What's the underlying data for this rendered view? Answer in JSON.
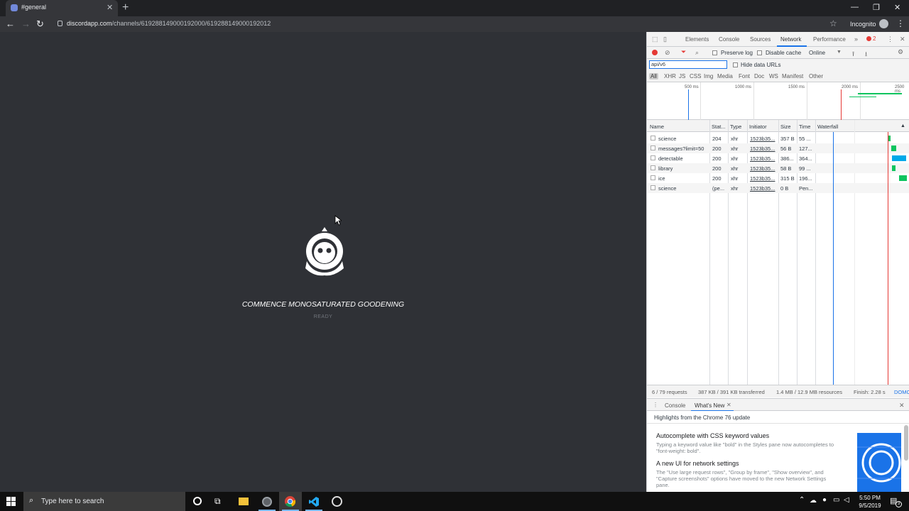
{
  "browser": {
    "tab_title": "#general",
    "url_host": "discordapp.com",
    "url_path": "/channels/619288149000192000/619288149000192012",
    "profile_label": "Incognito"
  },
  "discord": {
    "tagline": "COMMENCE MONOSATURATED GOODENING",
    "status": "READY"
  },
  "devtools": {
    "tabs": [
      "Elements",
      "Console",
      "Sources",
      "Network",
      "Performance"
    ],
    "error_count": "2",
    "toolbar": {
      "preserve_log": "Preserve log",
      "disable_cache": "Disable cache",
      "throttle": "Online"
    },
    "filter_value": "api/v6",
    "hide_data_urls": "Hide data URLs",
    "type_filters": [
      "All",
      "XHR",
      "JS",
      "CSS",
      "Img",
      "Media",
      "Font",
      "Doc",
      "WS",
      "Manifest",
      "Other"
    ],
    "overview_ticks": [
      "500 ms",
      "1000 ms",
      "1500 ms",
      "2000 ms",
      "2500 ms"
    ],
    "columns": [
      "Name",
      "Stat...",
      "Type",
      "Initiator",
      "Size",
      "Time",
      "Waterfall"
    ],
    "requests": [
      {
        "name": "science",
        "status": "204",
        "type": "xhr",
        "initiator": "1523b35...",
        "size": "357 B",
        "time": "55 ..."
      },
      {
        "name": "messages?limit=50",
        "status": "200",
        "type": "xhr",
        "initiator": "1523b35...",
        "size": "56 B",
        "time": "127..."
      },
      {
        "name": "detectable",
        "status": "200",
        "type": "xhr",
        "initiator": "1523b35...",
        "size": "386...",
        "time": "364..."
      },
      {
        "name": "library",
        "status": "200",
        "type": "xhr",
        "initiator": "1523b35...",
        "size": "58 B",
        "time": "99 ..."
      },
      {
        "name": "ice",
        "status": "200",
        "type": "xhr",
        "initiator": "1523b35...",
        "size": "315 B",
        "time": "196..."
      },
      {
        "name": "science",
        "status": "(pe...",
        "type": "xhr",
        "initiator": "1523b35...",
        "size": "0 B",
        "time": "Pen..."
      }
    ],
    "summary": {
      "requests": "6 / 79 requests",
      "transferred": "387 KB / 391 KB transferred",
      "resources": "1.4 MB / 12.9 MB resources",
      "finish": "Finish: 2.28 s",
      "domcontent": "DOMC"
    },
    "drawer": {
      "tabs": [
        "Console",
        "What's New"
      ],
      "highlights": "Highlights from the Chrome 76 update",
      "items": [
        {
          "title": "Autocomplete with CSS keyword values",
          "body": "Typing a keyword value like \"bold\" in the Styles pane now autocompletes to \"font-weight: bold\"."
        },
        {
          "title": "A new UI for network settings",
          "body": "The \"Use large request rows\", \"Group by frame\", \"Show overview\", and \"Capture screenshots\" options have moved to the new Network Settings pane."
        }
      ]
    }
  },
  "taskbar": {
    "search_placeholder": "Type here to search",
    "time": "5:50 PM",
    "date": "9/5/2019",
    "notification_count": "3"
  },
  "colors": {
    "discord_bg": "#2f3136",
    "chrome_dark": "#202124",
    "accent_blue": "#1a73e8",
    "record_red": "#e53935",
    "waterfall_green": "#0cc45e",
    "waterfall_blue": "#00a9e9"
  }
}
